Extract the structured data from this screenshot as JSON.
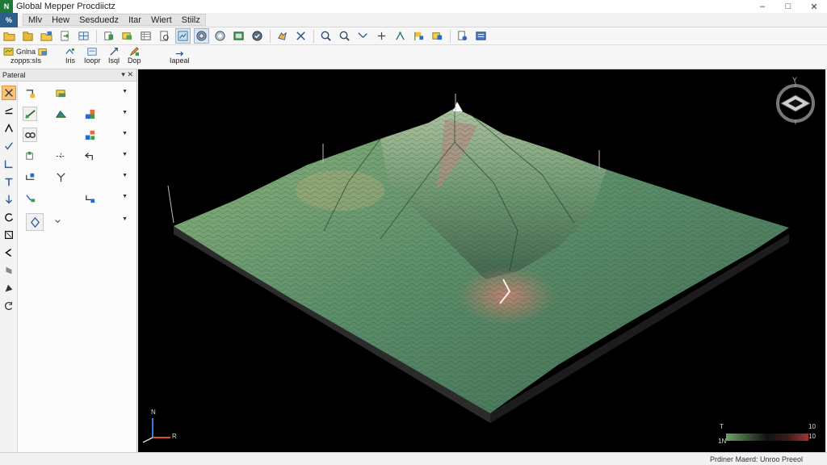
{
  "window": {
    "title": "Global Mepper Procdiictz",
    "icon_text": "N",
    "minimize": "–",
    "maximize": "□",
    "close": "✕"
  },
  "menubar": {
    "logo_text": "%",
    "items": [
      "Mlv",
      "Hew",
      "Sesduedz",
      "Itar",
      "Wiert",
      "Stiilz"
    ]
  },
  "toolbar2": {
    "groups": [
      {
        "label_top": "Gnlna",
        "label_bottom": "zopps:sIs"
      },
      {
        "label_top": "",
        "label_bottom": "Iris"
      },
      {
        "label_top": "",
        "label_bottom": "Ioopr"
      },
      {
        "label_top": "",
        "label_bottom": "Isql"
      },
      {
        "label_top": "",
        "label_bottom": "Dop"
      },
      {
        "label_top": "",
        "label_bottom": "Iapeal"
      }
    ]
  },
  "panel": {
    "title": "Pateral",
    "pin": "▾",
    "close": "✕"
  },
  "viewport": {
    "compass_label": "Y",
    "axis_x": "R",
    "axis_y": "N",
    "legend_top_left": "T",
    "legend_top_right": "10",
    "legend_bottom_left": "1N",
    "legend_bottom_right": "10"
  },
  "status": {
    "text": "Prdiner Maerd: Unroo Preeol"
  },
  "colors": {
    "accent": "#1f7a3a",
    "terrain_low": "#6fa26a",
    "terrain_high": "#a83030",
    "viewport_bg": "#000000"
  }
}
